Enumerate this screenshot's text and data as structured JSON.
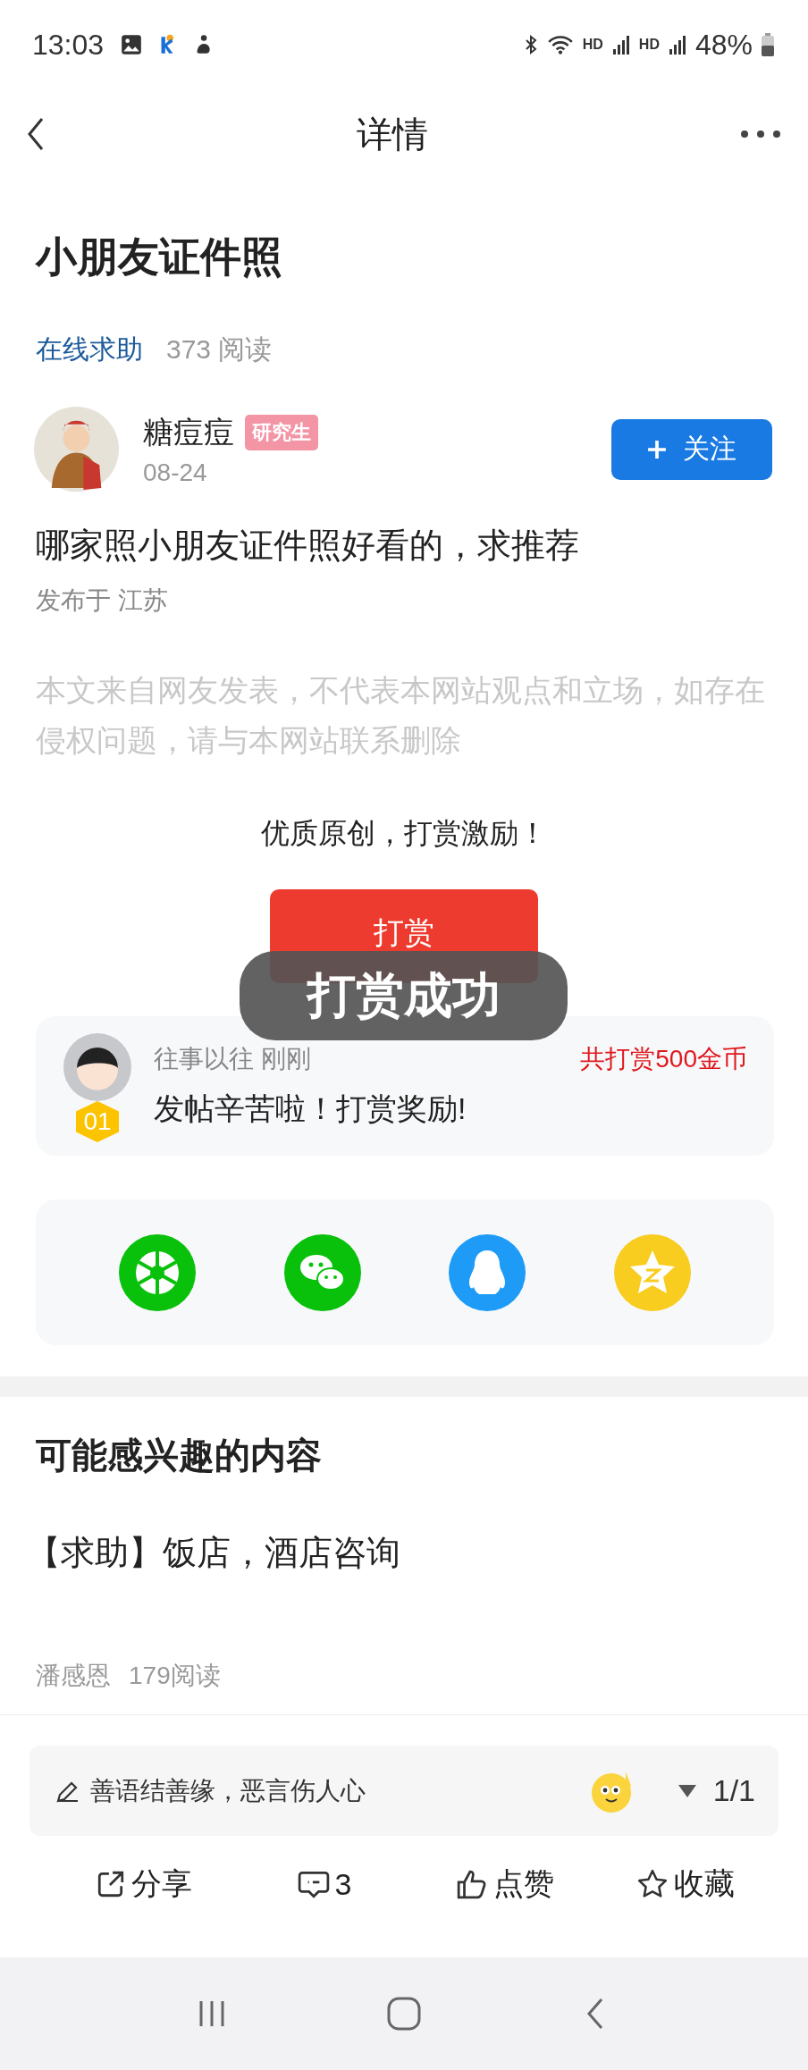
{
  "status_bar": {
    "time": "13:03",
    "network_labels": [
      "HD",
      "HD"
    ],
    "battery": "48%"
  },
  "header": {
    "title": "详情"
  },
  "post": {
    "title": "小朋友证件照",
    "category": "在线求助",
    "reads": "373 阅读",
    "author": {
      "name": "糖痘痘",
      "badge": "研究生",
      "date": "08-24"
    },
    "follow_button": "关注",
    "body": "哪家照小朋友证件照好看的，求推荐",
    "location": "发布于 江苏",
    "disclaimer": "本文来自网友发表，不代表本网站观点和立场，如存在侵权问题，请与本网站联系删除"
  },
  "reward": {
    "prompt": "优质原创，打赏激励！",
    "button": "打赏",
    "toast": "打赏成功",
    "record": {
      "user": "往事以往",
      "time": "刚刚",
      "rank": "01",
      "total": "共打赏500金币",
      "message": "发帖辛苦啦！打赏奖励!"
    }
  },
  "share_targets": [
    {
      "kind": "moments"
    },
    {
      "kind": "wechat"
    },
    {
      "kind": "qq"
    },
    {
      "kind": "qzone"
    }
  ],
  "related": {
    "title": "可能感兴趣的内容",
    "items": [
      {
        "title": "【求助】饭店，酒店咨询",
        "author": "潘感恩",
        "reads": "179阅读"
      }
    ]
  },
  "comment_bar": {
    "placeholder": "善语结善缘，恶言伤人心",
    "page": "1/1"
  },
  "actions": [
    {
      "kind": "share",
      "label": "分享"
    },
    {
      "kind": "comment",
      "label": "3"
    },
    {
      "kind": "like",
      "label": "点赞"
    },
    {
      "kind": "favorite",
      "label": "收藏"
    }
  ]
}
